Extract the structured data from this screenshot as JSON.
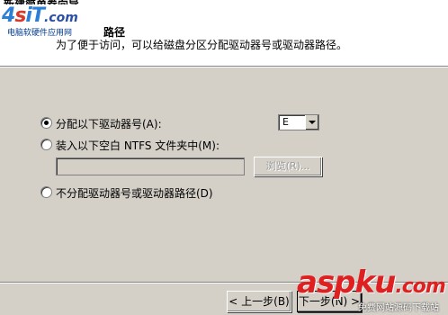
{
  "window": {
    "title_fragment": "新建简单卷向导"
  },
  "header": {
    "heading": "路径",
    "subtitle": "为了便于访问，可以给磁盘分区分配驱动器号或驱动器路径。"
  },
  "logo": {
    "four": "4",
    "s": "s",
    "it": "iT",
    "com": ".com",
    "tagline": "电脑软硬件应用网"
  },
  "options": {
    "assign_letter": {
      "label": "分配以下驱动器号(A):",
      "selected": true
    },
    "mount_folder": {
      "label": "装入以下空白 NTFS 文件夹中(M):",
      "selected": false
    },
    "no_assign": {
      "label": "不分配驱动器号或驱动器路径(D)",
      "selected": false
    }
  },
  "drive_select": {
    "value": "E"
  },
  "folder_path": {
    "value": ""
  },
  "buttons": {
    "browse": "浏览(R)...",
    "back": "< 上一步(B)",
    "next": "下一步(N) >"
  },
  "watermark": {
    "brand": "aspku",
    "suffix": ".com",
    "tagline": "免费网站源码下载站"
  }
}
